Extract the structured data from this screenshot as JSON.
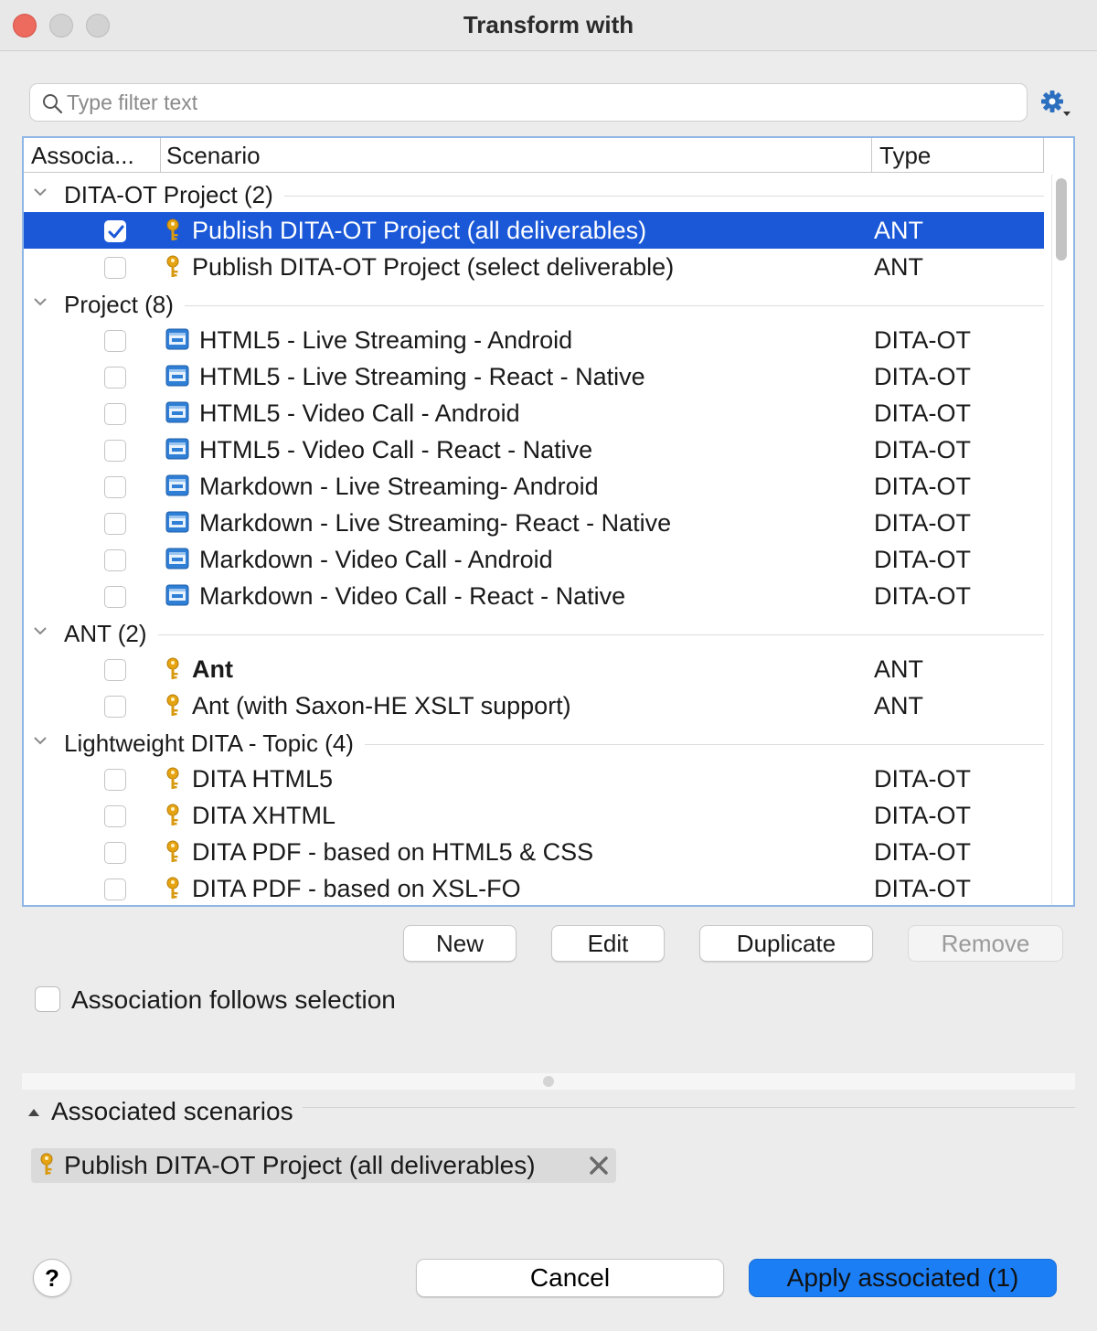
{
  "window": {
    "title": "Transform with"
  },
  "search": {
    "placeholder": "Type filter text",
    "value": ""
  },
  "table": {
    "headers": {
      "association": "Associa...",
      "scenario": "Scenario",
      "type": "Type"
    },
    "groups": [
      {
        "label": "DITA-OT Project (2)",
        "rows": [
          {
            "name": "Publish DITA-OT Project (all deliverables)",
            "type": "ANT",
            "icon": "key-icon",
            "checked": true,
            "selected": true,
            "bold": false
          },
          {
            "name": "Publish DITA-OT Project (select deliverable)",
            "type": "ANT",
            "icon": "key-icon",
            "checked": false,
            "selected": false,
            "bold": false
          }
        ]
      },
      {
        "label": "Project (8)",
        "rows": [
          {
            "name": "HTML5 - Live Streaming - Android",
            "type": "DITA-OT",
            "icon": "scenario-icon",
            "checked": false,
            "selected": false,
            "bold": false
          },
          {
            "name": "HTML5 - Live Streaming - React - Native",
            "type": "DITA-OT",
            "icon": "scenario-icon",
            "checked": false,
            "selected": false,
            "bold": false
          },
          {
            "name": "HTML5 - Video Call - Android",
            "type": "DITA-OT",
            "icon": "scenario-icon",
            "checked": false,
            "selected": false,
            "bold": false
          },
          {
            "name": "HTML5 - Video Call - React - Native",
            "type": "DITA-OT",
            "icon": "scenario-icon",
            "checked": false,
            "selected": false,
            "bold": false
          },
          {
            "name": "Markdown - Live Streaming- Android",
            "type": "DITA-OT",
            "icon": "scenario-icon",
            "checked": false,
            "selected": false,
            "bold": false
          },
          {
            "name": "Markdown - Live Streaming- React - Native",
            "type": "DITA-OT",
            "icon": "scenario-icon",
            "checked": false,
            "selected": false,
            "bold": false
          },
          {
            "name": "Markdown - Video Call - Android",
            "type": "DITA-OT",
            "icon": "scenario-icon",
            "checked": false,
            "selected": false,
            "bold": false
          },
          {
            "name": "Markdown - Video Call - React - Native",
            "type": "DITA-OT",
            "icon": "scenario-icon",
            "checked": false,
            "selected": false,
            "bold": false
          }
        ]
      },
      {
        "label": "ANT (2)",
        "rows": [
          {
            "name": "Ant",
            "type": "ANT",
            "icon": "key-icon",
            "checked": false,
            "selected": false,
            "bold": true
          },
          {
            "name": "Ant (with Saxon-HE XSLT support)",
            "type": "ANT",
            "icon": "key-icon",
            "checked": false,
            "selected": false,
            "bold": false
          }
        ]
      },
      {
        "label": "Lightweight DITA - Topic (4)",
        "rows": [
          {
            "name": "DITA HTML5",
            "type": "DITA-OT",
            "icon": "key-icon",
            "checked": false,
            "selected": false,
            "bold": false
          },
          {
            "name": "DITA XHTML",
            "type": "DITA-OT",
            "icon": "key-icon",
            "checked": false,
            "selected": false,
            "bold": false
          },
          {
            "name": "DITA PDF - based on HTML5 & CSS",
            "type": "DITA-OT",
            "icon": "key-icon",
            "checked": false,
            "selected": false,
            "bold": false
          },
          {
            "name": "DITA PDF - based on XSL-FO",
            "type": "DITA-OT",
            "icon": "key-icon",
            "checked": false,
            "selected": false,
            "bold": false
          }
        ]
      }
    ]
  },
  "actions": {
    "new": "New",
    "edit": "Edit",
    "duplicate": "Duplicate",
    "remove": "Remove"
  },
  "follow": {
    "label": "Association follows selection",
    "checked": false
  },
  "associated": {
    "title": "Associated scenarios",
    "chips": [
      {
        "label": "Publish DITA-OT Project (all deliverables)",
        "icon": "key-icon"
      }
    ]
  },
  "footer": {
    "help": "?",
    "cancel": "Cancel",
    "apply": "Apply associated (1)"
  },
  "colors": {
    "selection": "#1a58d8",
    "primary_button": "#1b7ef5",
    "key_icon": "#e6a412",
    "scenario_icon": "#2f7fd6",
    "close_traffic_light": "#ed6a5e"
  }
}
